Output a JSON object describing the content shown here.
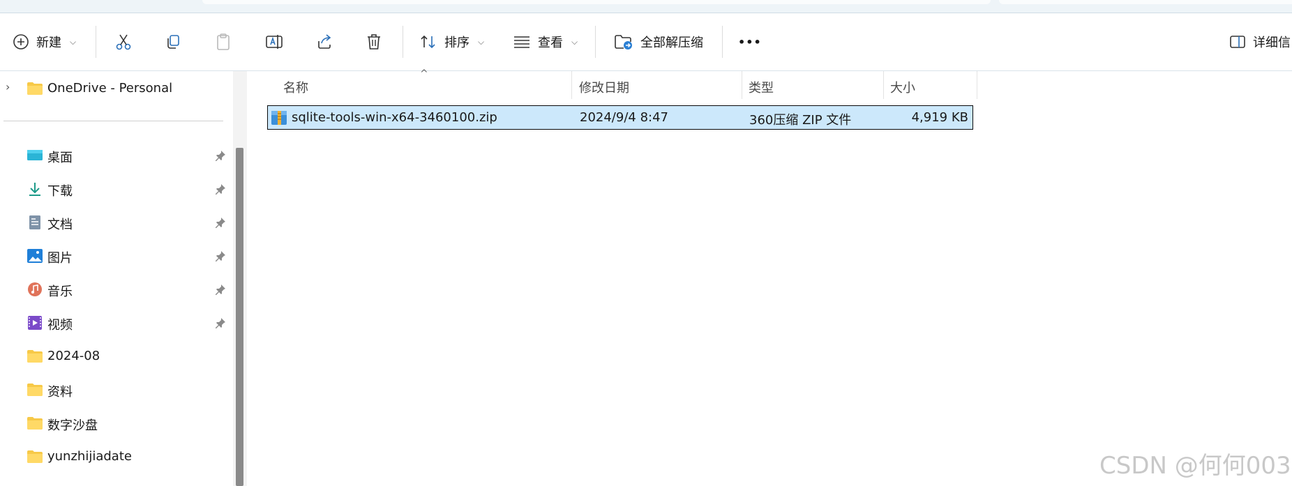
{
  "toolbar": {
    "new_label": "新建",
    "sort_label": "排序",
    "view_label": "查看",
    "extract_all_label": "全部解压缩",
    "more_label": "•••",
    "details_label": "详细信"
  },
  "sidebar": {
    "onedrive": "OneDrive - Personal",
    "items": [
      {
        "label": "桌面",
        "icon": "desktop-icon",
        "pinned": true
      },
      {
        "label": "下载",
        "icon": "download-icon",
        "pinned": true
      },
      {
        "label": "文档",
        "icon": "document-icon",
        "pinned": true
      },
      {
        "label": "图片",
        "icon": "pictures-icon",
        "pinned": true
      },
      {
        "label": "音乐",
        "icon": "music-icon",
        "pinned": true
      },
      {
        "label": "视频",
        "icon": "video-icon",
        "pinned": true
      },
      {
        "label": "2024-08",
        "icon": "folder-icon",
        "pinned": false
      },
      {
        "label": "资料",
        "icon": "folder-icon",
        "pinned": false
      },
      {
        "label": "数字沙盘",
        "icon": "folder-icon",
        "pinned": false
      },
      {
        "label": "yunzhijiadate",
        "icon": "folder-icon",
        "pinned": false
      }
    ]
  },
  "columns": {
    "name": "名称",
    "modified": "修改日期",
    "type": "类型",
    "size": "大小"
  },
  "files": [
    {
      "name": "sqlite-tools-win-x64-3460100.zip",
      "modified": "2024/9/4 8:47",
      "type": "360压缩 ZIP 文件",
      "size": "4,919 KB"
    }
  ],
  "watermark": "CSDN @何何003",
  "colors": {
    "selection": "#cce8fb",
    "folder": "#f7c948",
    "accent": "#0067c0"
  }
}
